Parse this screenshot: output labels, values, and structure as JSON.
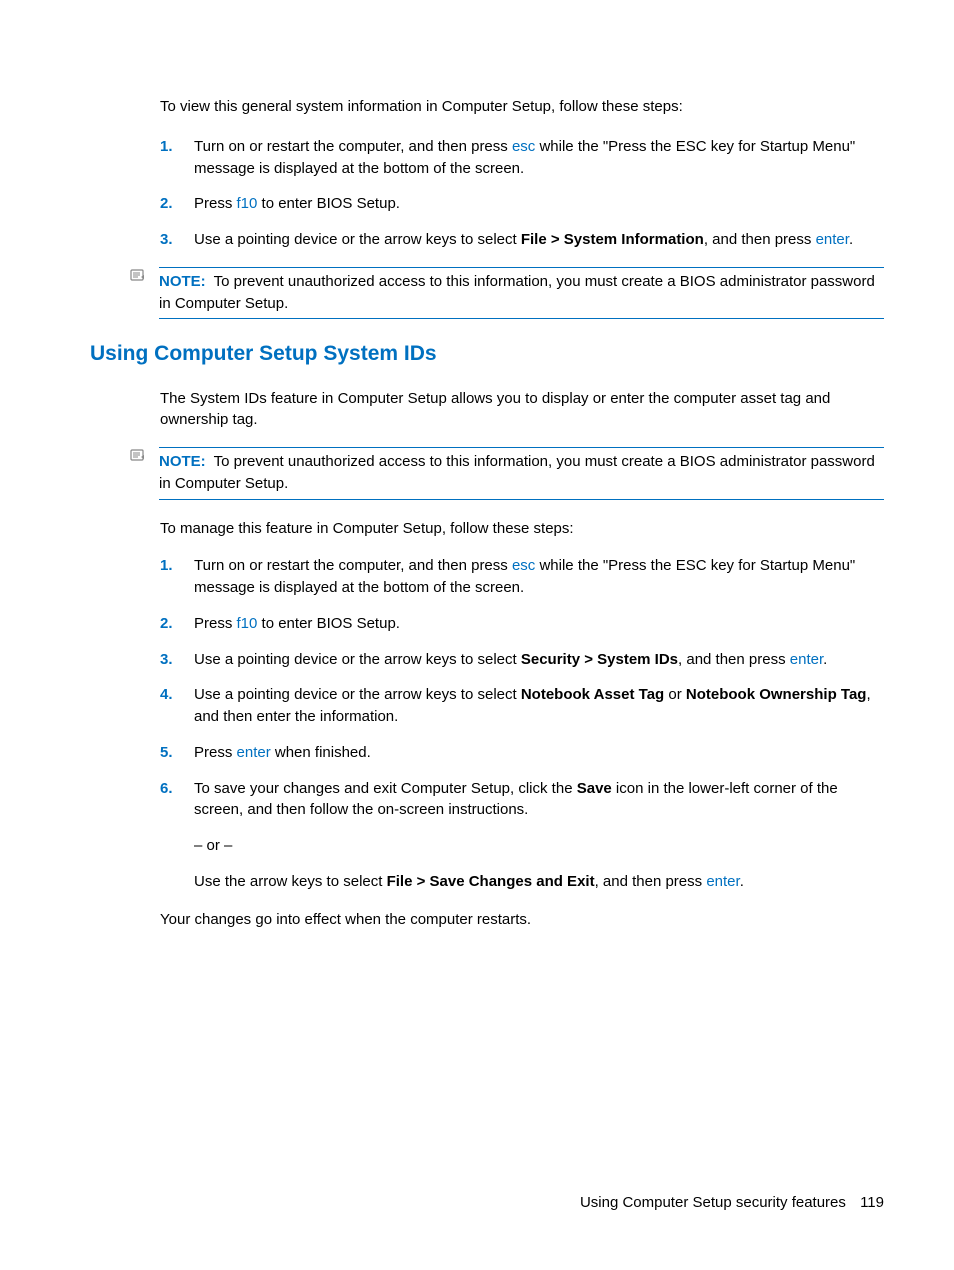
{
  "section1": {
    "intro": "To view this general system information in Computer Setup, follow these steps:",
    "steps": {
      "s1": {
        "num": "1.",
        "pre": "Turn on or restart the computer, and then press ",
        "key": "esc",
        "post": " while the \"Press the ESC key for Startup Menu\" message is displayed at the bottom of the screen."
      },
      "s2": {
        "num": "2.",
        "pre": "Press ",
        "key": "f10",
        "post": " to enter BIOS Setup."
      },
      "s3": {
        "num": "3.",
        "pre": "Use a pointing device or the arrow keys to select ",
        "bold": "File > System Information",
        "mid": ", and then press ",
        "key": "enter",
        "post": "."
      }
    },
    "note": {
      "label": "NOTE:",
      "text": "To prevent unauthorized access to this information, you must create a BIOS administrator password in Computer Setup."
    }
  },
  "section2": {
    "heading": "Using Computer Setup System IDs",
    "intro": "The System IDs feature in Computer Setup allows you to display or enter the computer asset tag and ownership tag.",
    "note": {
      "label": "NOTE:",
      "text": "To prevent unauthorized access to this information, you must create a BIOS administrator password in Computer Setup."
    },
    "intro2": "To manage this feature in Computer Setup, follow these steps:",
    "steps": {
      "s1": {
        "num": "1.",
        "pre": "Turn on or restart the computer, and then press ",
        "key": "esc",
        "post": " while the \"Press the ESC key for Startup Menu\" message is displayed at the bottom of the screen."
      },
      "s2": {
        "num": "2.",
        "pre": "Press ",
        "key": "f10",
        "post": " to enter BIOS Setup."
      },
      "s3": {
        "num": "3.",
        "pre": "Use a pointing device or the arrow keys to select ",
        "bold": "Security > System IDs",
        "mid": ", and then press ",
        "key": "enter",
        "post": "."
      },
      "s4": {
        "num": "4.",
        "pre": "Use a pointing device or the arrow keys to select ",
        "bold1": "Notebook Asset Tag",
        "mid1": " or ",
        "bold2": "Notebook Ownership Tag",
        "post": ", and then enter the information."
      },
      "s5": {
        "num": "5.",
        "pre": "Press ",
        "key": "enter",
        "post": " when finished."
      },
      "s6": {
        "num": "6.",
        "pre": "To save your changes and exit Computer Setup, click the ",
        "bold": "Save",
        "post": " icon in the lower-left corner of the screen, and then follow the on-screen instructions.",
        "or": "– or –",
        "alt_pre": "Use the arrow keys to select ",
        "alt_bold": "File > Save Changes and Exit",
        "alt_mid": ", and then press ",
        "alt_key": "enter",
        "alt_post": "."
      }
    },
    "outro": "Your changes go into effect when the computer restarts."
  },
  "footer": {
    "text": "Using Computer Setup security features",
    "page": "119"
  }
}
